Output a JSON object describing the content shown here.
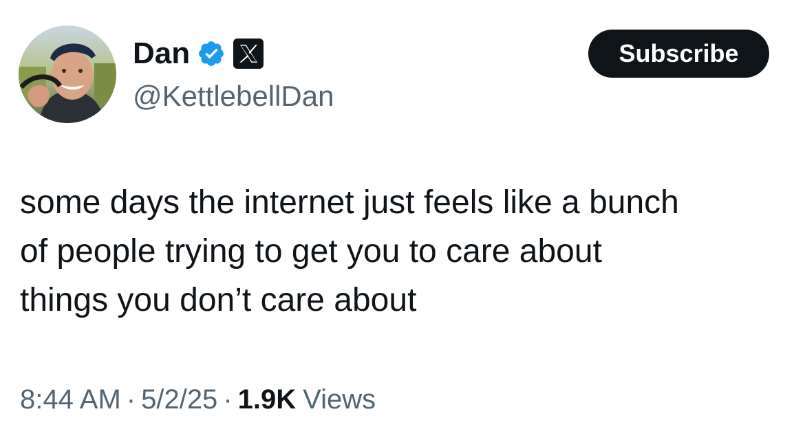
{
  "author": {
    "display_name": "Dan",
    "handle": "@KettlebellDan",
    "verified_icon": "verified-checkmark-icon",
    "platform_icon": "x-logo-icon"
  },
  "subscribe_button": {
    "label": "Subscribe"
  },
  "tweet": {
    "text_lines": [
      "some days the internet just feels like a bunch",
      "of people trying to get you to care about",
      "things you don’t care about"
    ]
  },
  "meta": {
    "time": "8:44 AM",
    "separator": "·",
    "date": "5/2/25",
    "views_count": "1.9K",
    "views_label": "Views"
  },
  "colors": {
    "text_primary": "#0f1419",
    "text_secondary": "#536471",
    "verified_blue": "#1d9bf0",
    "button_bg": "#0f1419",
    "button_text": "#ffffff"
  }
}
